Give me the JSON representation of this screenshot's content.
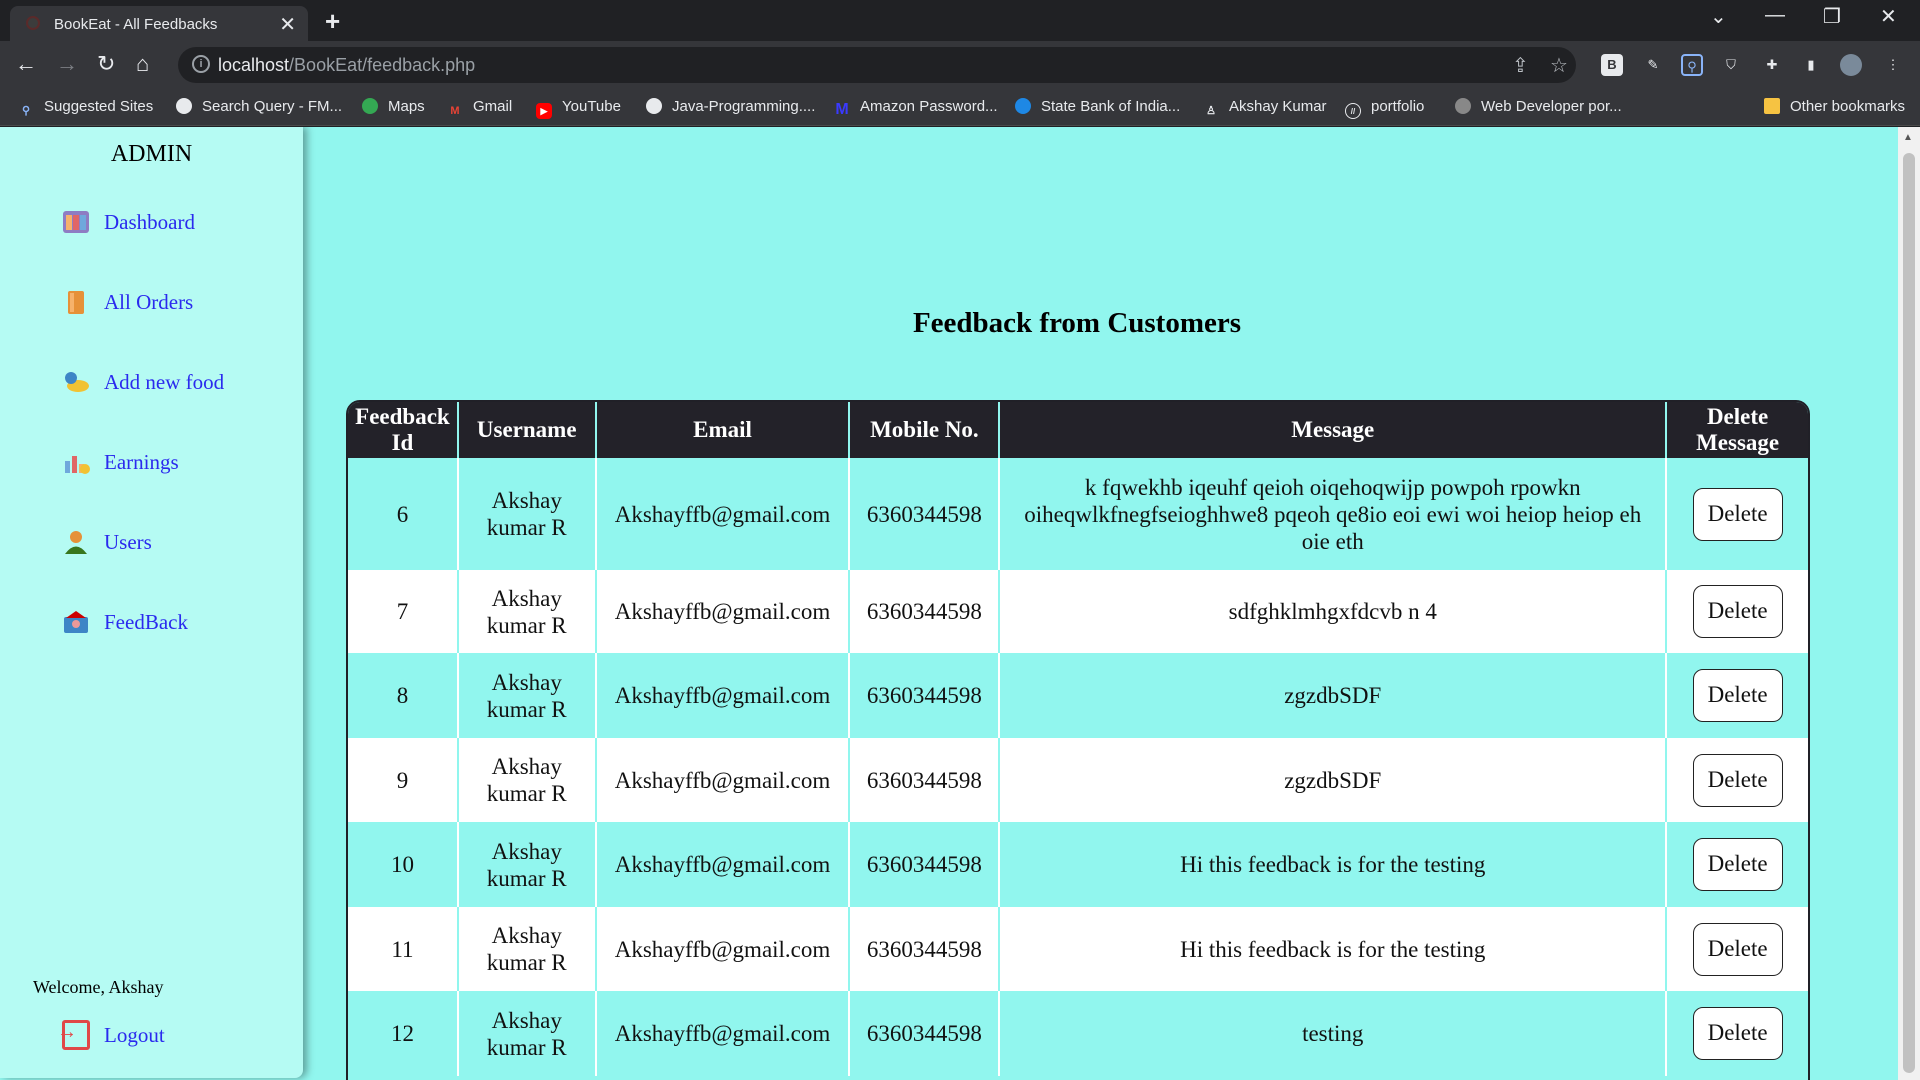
{
  "browser": {
    "tab_title": "BookEat - All Feedbacks",
    "tab_close": "✕",
    "new_tab": "+",
    "url_host": "localhost",
    "url_path": "/BookEat/feedback.php",
    "bookmarks": [
      {
        "label": "Suggested Sites",
        "color": "#8ab4f8",
        "glyph": "⚲"
      },
      {
        "label": "Search Query - FM...",
        "color": "#e8eaed",
        "glyph": "◉"
      },
      {
        "label": "Maps",
        "color": "#34a853",
        "glyph": "⬤"
      },
      {
        "label": "Gmail",
        "color": "#ea4335",
        "glyph": "M"
      },
      {
        "label": "YouTube",
        "color": "#ff0000",
        "glyph": "▶"
      },
      {
        "label": "Java-Programming....",
        "color": "#e8eaed",
        "glyph": "◉"
      },
      {
        "label": "Amazon Password...",
        "color": "#1a1aff",
        "glyph": "M"
      },
      {
        "label": "State Bank of India...",
        "color": "#1e88e5",
        "glyph": "◍"
      },
      {
        "label": "Akshay Kumar",
        "color": "#e8eaed",
        "glyph": "⌂"
      },
      {
        "label": "portfolio",
        "color": "#e8eaed",
        "glyph": "//"
      },
      {
        "label": "Web Developer por...",
        "color": "#e8eaed",
        "glyph": "●"
      }
    ],
    "other_bookmarks": "Other bookmarks"
  },
  "sidebar": {
    "title": "ADMIN",
    "items": [
      {
        "label": "Dashboard",
        "icon": "dashboard-icon"
      },
      {
        "label": "All Orders",
        "icon": "orders-icon"
      },
      {
        "label": "Add new food",
        "icon": "food-icon"
      },
      {
        "label": "Earnings",
        "icon": "earnings-icon"
      },
      {
        "label": "Users",
        "icon": "users-icon"
      },
      {
        "label": "FeedBack",
        "icon": "feedback-icon"
      }
    ],
    "welcome": "Welcome, Akshay",
    "logout": "Logout"
  },
  "main": {
    "title": "Feedback from Customers",
    "columns": [
      "Feedback Id",
      "Username",
      "Email",
      "Mobile No.",
      "Message",
      "Delete Message"
    ],
    "delete_label": "Delete",
    "rows": [
      {
        "id": "6",
        "username": "Akshay kumar R",
        "email": "Akshayffb@gmail.com",
        "mobile": "6360344598",
        "message": "k fqwekhb iqeuhf qeioh oiqehoqwijp powpoh rpowkn oiheqwlkfnegfseioghhwe8 pqeoh qe8io eoi ewi woi heiop heiop eh oie eth"
      },
      {
        "id": "7",
        "username": "Akshay kumar R",
        "email": "Akshayffb@gmail.com",
        "mobile": "6360344598",
        "message": "sdfghklmhgxfdcvb n 4"
      },
      {
        "id": "8",
        "username": "Akshay kumar R",
        "email": "Akshayffb@gmail.com",
        "mobile": "6360344598",
        "message": "zgzdbSDF"
      },
      {
        "id": "9",
        "username": "Akshay kumar R",
        "email": "Akshayffb@gmail.com",
        "mobile": "6360344598",
        "message": "zgzdbSDF"
      },
      {
        "id": "10",
        "username": "Akshay kumar R",
        "email": "Akshayffb@gmail.com",
        "mobile": "6360344598",
        "message": "Hi this feedback is for the testing"
      },
      {
        "id": "11",
        "username": "Akshay kumar R",
        "email": "Akshayffb@gmail.com",
        "mobile": "6360344598",
        "message": "Hi this feedback is for the testing"
      },
      {
        "id": "12",
        "username": "Akshay kumar R",
        "email": "Akshayffb@gmail.com",
        "mobile": "6360344598",
        "message": "testing"
      }
    ]
  },
  "colors": {
    "page_bg": "#91f6ee",
    "sidebar_bg": "#b5fbf3",
    "link": "#2a2aee",
    "header_bg": "#232229"
  }
}
